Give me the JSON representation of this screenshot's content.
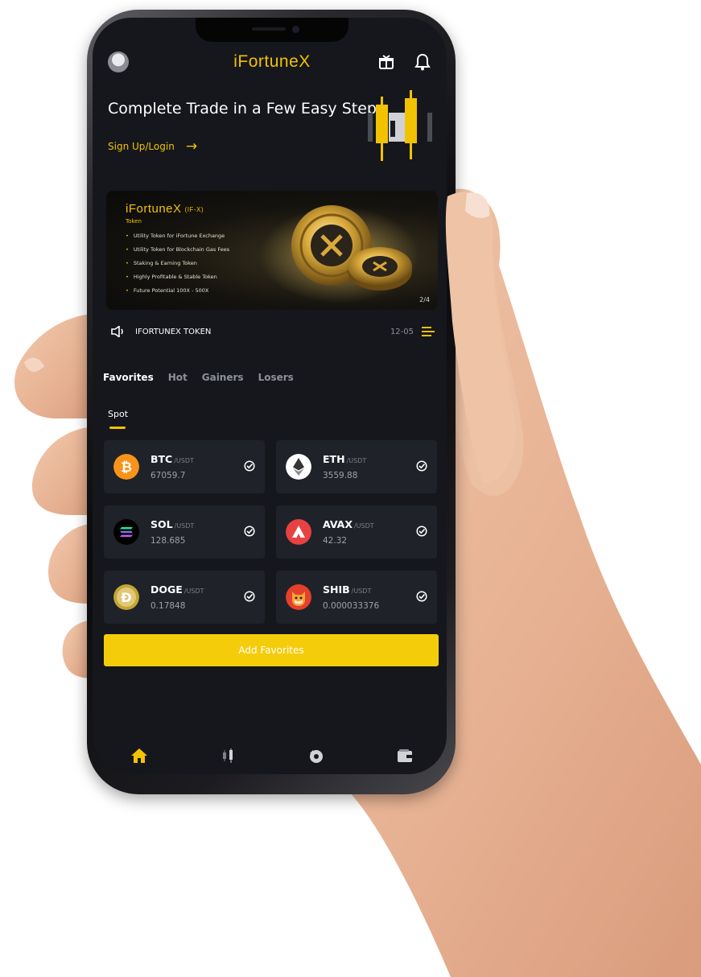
{
  "app": {
    "logo_text": "iFortuneX"
  },
  "hero": {
    "title": "Complete Trade in a Few Easy Steps",
    "signup_label": "Sign Up/Login",
    "arrow": "→"
  },
  "banner": {
    "title": "iFortuneX",
    "title_sub": "(IF-X)",
    "token_label": "Token",
    "bullets": [
      "Utility Token for iFortune Exchange",
      "Utility Token for Blockchain Gas Fees",
      "Staking & Earning Token",
      "Highly Profitable & Stable Token",
      "Future Potential 100X - 500X"
    ],
    "page": "2/4"
  },
  "announcement": {
    "text": "IFORTUNEX TOKEN",
    "date": "12-05"
  },
  "tabs": [
    "Favorites",
    "Hot",
    "Gainers",
    "Losers"
  ],
  "active_tab": "Favorites",
  "subtab": "Spot",
  "coins": [
    {
      "symbol": "BTC",
      "pair": "/USDT",
      "price": "67059.7",
      "icon": "bitcoin-icon",
      "color": "#f7931a"
    },
    {
      "symbol": "ETH",
      "pair": "/USDT",
      "price": "3559.88",
      "icon": "ethereum-icon",
      "color": "#ffffff"
    },
    {
      "symbol": "SOL",
      "pair": "/USDT",
      "price": "128.685",
      "icon": "solana-icon",
      "color": "#000000"
    },
    {
      "symbol": "AVAX",
      "pair": "/USDT",
      "price": "42.32",
      "icon": "avalanche-icon",
      "color": "#e84142"
    },
    {
      "symbol": "DOGE",
      "pair": "/USDT",
      "price": "0.17848",
      "icon": "dogecoin-icon",
      "color": "#c2a633"
    },
    {
      "symbol": "SHIB",
      "pair": "/USDT",
      "price": "0.000033376",
      "icon": "shiba-icon",
      "color": "#e4402b"
    }
  ],
  "add_button": "Add Favorites",
  "nav": [
    "home-icon",
    "markets-icon",
    "trade-icon",
    "wallet-icon"
  ],
  "colors": {
    "accent": "#f2c200",
    "background": "#15171d",
    "card": "#1f2229"
  }
}
